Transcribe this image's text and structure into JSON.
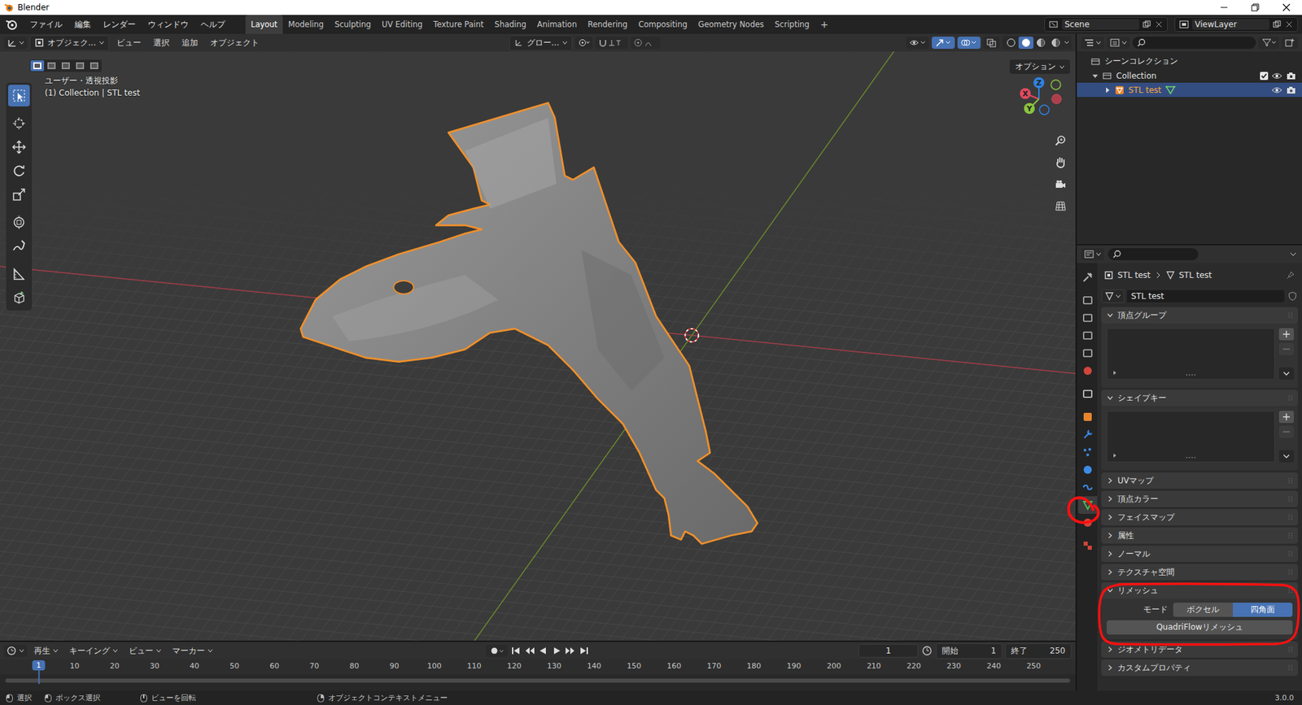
{
  "window": {
    "title": "Blender"
  },
  "menu": [
    "ファイル",
    "編集",
    "レンダー",
    "ウィンドウ",
    "ヘルプ"
  ],
  "workspaces": [
    {
      "label": "Layout",
      "selected": true
    },
    {
      "label": "Modeling",
      "selected": false
    },
    {
      "label": "Sculpting",
      "selected": false
    },
    {
      "label": "UV Editing",
      "selected": false
    },
    {
      "label": "Texture Paint",
      "selected": false
    },
    {
      "label": "Shading",
      "selected": false
    },
    {
      "label": "Animation",
      "selected": false
    },
    {
      "label": "Rendering",
      "selected": false
    },
    {
      "label": "Compositing",
      "selected": false
    },
    {
      "label": "Geometry Nodes",
      "selected": false
    },
    {
      "label": "Scripting",
      "selected": false
    }
  ],
  "add_workspace": "+",
  "scene": "Scene",
  "view_layer": "ViewLayer",
  "viewport": {
    "mode": "オブジェク...",
    "menus": [
      "ビュー",
      "選択",
      "追加",
      "オブジェクト"
    ],
    "orientation": "グロー...",
    "options": "オプション",
    "view_name": "ユーザー・透視投影",
    "context": "(1) Collection | STL test",
    "select_modes": [
      {
        "selected": true
      },
      {
        "selected": false
      },
      {
        "selected": false
      },
      {
        "selected": false
      },
      {
        "selected": false
      }
    ],
    "shading": [
      {
        "selected": false
      },
      {
        "selected": true
      },
      {
        "selected": false
      },
      {
        "selected": false
      }
    ],
    "tools": [
      {
        "kind": "select",
        "selected": true
      },
      {
        "kind": "cursor",
        "selected": false
      },
      {
        "kind": "move",
        "selected": false
      },
      {
        "kind": "rotate",
        "selected": false
      },
      {
        "kind": "scale",
        "selected": false
      },
      {
        "kind": "transform",
        "selected": false
      },
      {
        "kind": "annotate",
        "selected": false
      },
      {
        "kind": "measure",
        "selected": false
      },
      {
        "kind": "add-cube",
        "selected": false
      }
    ],
    "gizmo": [
      {
        "label": "Z",
        "color": "#2f83e3"
      },
      {
        "label": "X",
        "color": "#e54a5f"
      },
      {
        "label": "Y",
        "color": "#8bc53f"
      }
    ]
  },
  "outliner": {
    "root": "シーンコレクション",
    "collection": {
      "label": "Collection",
      "expanded": true,
      "checked": true,
      "visible": true,
      "renderable": true
    },
    "items": [
      {
        "label": "STL test",
        "expanded": false,
        "selected": true,
        "visible": true,
        "renderable": true
      }
    ]
  },
  "properties": {
    "breadcrumb": [
      "STL test",
      "STL test"
    ],
    "mesh_name": "STL test",
    "tabs": [
      {
        "kind": "tool",
        "selected": false
      },
      {
        "kind": "render",
        "selected": false
      },
      {
        "kind": "output",
        "selected": false
      },
      {
        "kind": "view",
        "selected": false
      },
      {
        "kind": "scene",
        "selected": false
      },
      {
        "kind": "world",
        "selected": false
      },
      {
        "kind": "collection",
        "selected": false
      },
      {
        "kind": "object",
        "selected": false
      },
      {
        "kind": "modifier",
        "selected": false
      },
      {
        "kind": "particles",
        "selected": false
      },
      {
        "kind": "physics",
        "selected": false
      },
      {
        "kind": "constraints",
        "selected": false
      },
      {
        "kind": "data",
        "selected": true
      },
      {
        "kind": "material",
        "selected": false
      },
      {
        "kind": "texture",
        "selected": false
      }
    ],
    "panels": [
      {
        "label": "頂点グループ",
        "expanded": true,
        "kind": "list"
      },
      {
        "label": "シェイプキー",
        "expanded": true,
        "kind": "list"
      },
      {
        "label": "UVマップ",
        "expanded": false,
        "kind": "plain"
      },
      {
        "label": "頂点カラー",
        "expanded": false,
        "kind": "plain"
      },
      {
        "label": "フェイスマップ",
        "expanded": false,
        "kind": "plain"
      },
      {
        "label": "属性",
        "expanded": false,
        "kind": "plain"
      },
      {
        "label": "ノーマル",
        "expanded": false,
        "kind": "plain"
      },
      {
        "label": "テクスチャ空間",
        "expanded": false,
        "kind": "plain"
      },
      {
        "label": "リメッシュ",
        "expanded": true,
        "kind": "remesh"
      },
      {
        "label": "ジオメトリデータ",
        "expanded": false,
        "kind": "plain"
      },
      {
        "label": "カスタムプロパティ",
        "expanded": false,
        "kind": "plain"
      }
    ],
    "remesh": {
      "mode_label": "モード",
      "modes": [
        {
          "label": "ボクセル",
          "selected": false
        },
        {
          "label": "四角面",
          "selected": true
        }
      ],
      "button": "QuadriFlowリメッシュ"
    }
  },
  "timeline": {
    "menus": [
      "再生",
      "キーイング",
      "ビュー",
      "マーカー"
    ],
    "current": "1",
    "start_label": "開始",
    "start": "1",
    "end_label": "終了",
    "end": "250",
    "playhead": "1",
    "ticks": [
      "10",
      "20",
      "30",
      "40",
      "50",
      "60",
      "70",
      "80",
      "90",
      "100",
      "110",
      "120",
      "130",
      "140",
      "150",
      "160",
      "170",
      "180",
      "190",
      "200",
      "210",
      "220",
      "230",
      "240",
      "250"
    ]
  },
  "status_bar": {
    "hints": [
      "選択",
      "ボックス選択",
      "ビューを回転",
      "オブジェクトコンテキストメニュー"
    ],
    "version": "3.0.0"
  }
}
